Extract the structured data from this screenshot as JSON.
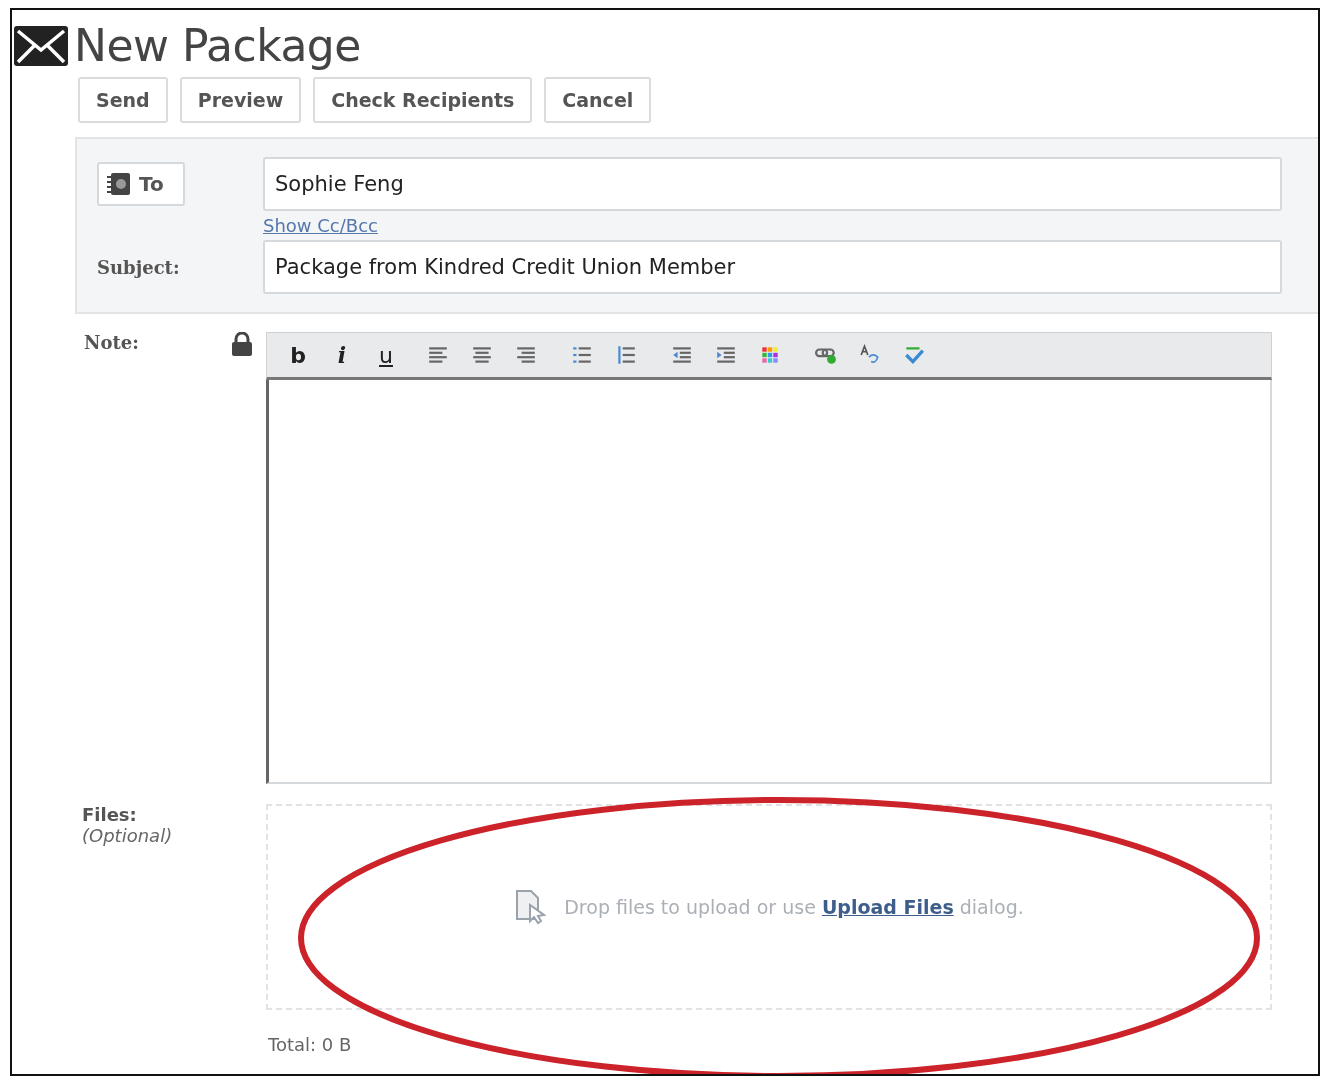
{
  "title": "New Package",
  "actions": [
    "Send",
    "Preview",
    "Check Recipients",
    "Cancel"
  ],
  "to_button": "To",
  "to_field": {
    "value": "Sophie Feng"
  },
  "show_cc_bcc": "Show Cc/Bcc",
  "subject_label": "Subject:",
  "subject_field": {
    "value": "Package from Kindred Credit Union Member"
  },
  "note_label": "Note:",
  "note_locked": true,
  "toolbar": [
    {
      "kind": "bold",
      "label": "b"
    },
    {
      "kind": "italic",
      "label": "i"
    },
    {
      "kind": "underline",
      "label": "u"
    },
    {
      "kind": "align-left"
    },
    {
      "kind": "align-center"
    },
    {
      "kind": "align-right"
    },
    {
      "kind": "bullets"
    },
    {
      "kind": "numbers"
    },
    {
      "kind": "outdent"
    },
    {
      "kind": "indent"
    },
    {
      "kind": "colors"
    },
    {
      "kind": "link"
    },
    {
      "kind": "font-style"
    },
    {
      "kind": "spellcheck"
    }
  ],
  "files_label": "Files:",
  "files_optional": "(Optional)",
  "drop_hint": {
    "before": "Drop files to upload or use",
    "link": "Upload Files",
    "after": "dialog."
  },
  "total": "Total: 0 B",
  "annotation": {
    "kind": "ellipse",
    "color": "#cc2229"
  }
}
